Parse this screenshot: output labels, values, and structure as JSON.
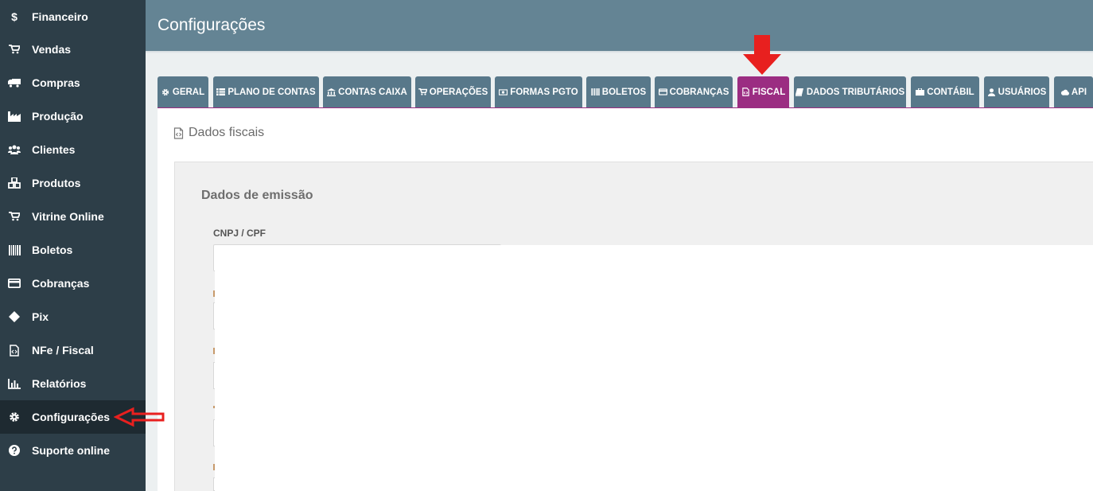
{
  "sidebar": {
    "items": [
      {
        "label": "Financeiro",
        "icon": "dollar-icon"
      },
      {
        "label": "Vendas",
        "icon": "cart-icon"
      },
      {
        "label": "Compras",
        "icon": "truck-icon"
      },
      {
        "label": "Produção",
        "icon": "factory-icon"
      },
      {
        "label": "Clientes",
        "icon": "users-icon"
      },
      {
        "label": "Produtos",
        "icon": "cubes-icon"
      },
      {
        "label": "Vitrine Online",
        "icon": "cart-icon"
      },
      {
        "label": "Boletos",
        "icon": "barcode-icon"
      },
      {
        "label": "Cobranças",
        "icon": "credit-card-icon"
      },
      {
        "label": "Pix",
        "icon": "pix-icon"
      },
      {
        "label": "NFe / Fiscal",
        "icon": "file-code-icon"
      },
      {
        "label": "Relatórios",
        "icon": "bar-chart-icon"
      },
      {
        "label": "Configurações",
        "icon": "gear-icon",
        "active": true
      },
      {
        "label": "Suporte online",
        "icon": "question-circle-icon"
      }
    ]
  },
  "header": {
    "title": "Configurações"
  },
  "tabs": [
    {
      "label": "GERAL",
      "icon": "gear-icon"
    },
    {
      "label": "PLANO DE CONTAS",
      "icon": "list-icon"
    },
    {
      "label": "CONTAS CAIXA",
      "icon": "bank-icon"
    },
    {
      "label": "OPERAÇÕES",
      "icon": "cart-icon"
    },
    {
      "label": "FORMAS PGTO",
      "icon": "money-icon"
    },
    {
      "label": "BOLETOS",
      "icon": "barcode-icon"
    },
    {
      "label": "COBRANÇAS",
      "icon": "credit-card-icon"
    },
    {
      "label": "FISCAL",
      "icon": "file-code-icon",
      "active": true
    },
    {
      "label": "DADOS TRIBUTÁRIOS",
      "icon": "book-icon"
    },
    {
      "label": "CONTÁBIL",
      "icon": "briefcase-icon"
    },
    {
      "label": "USUÁRIOS",
      "icon": "user-icon"
    },
    {
      "label": "API",
      "icon": "cloud-icon"
    }
  ],
  "main": {
    "section_title": "Dados fiscais",
    "panel_title": "Dados de emissão",
    "fields": [
      {
        "label": "CNPJ / CPF",
        "value": ""
      }
    ]
  },
  "colors": {
    "sidebar_bg": "#2d3e48",
    "header_bg": "#648494",
    "tab_bg": "#58788a",
    "tab_active": "#9b2d82",
    "annotation_red": "#e8201f"
  }
}
